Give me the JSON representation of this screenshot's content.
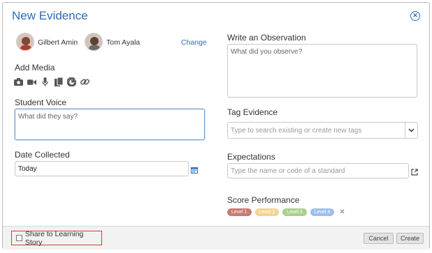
{
  "dialog": {
    "title": "New Evidence"
  },
  "people": [
    {
      "name": "Gilbert Amin"
    },
    {
      "name": "Tom Ayala"
    }
  ],
  "change_link": "Change",
  "add_media": {
    "label": "Add Media",
    "icons": [
      "camera-icon",
      "video-icon",
      "microphone-icon",
      "document-copy-icon",
      "google-icon",
      "link-icon"
    ]
  },
  "student_voice": {
    "label": "Student Voice",
    "placeholder": "What did they say?"
  },
  "date_collected": {
    "label": "Date Collected",
    "value": "Today"
  },
  "observation": {
    "label": "Write an Observation",
    "placeholder": "What did you observe?"
  },
  "tag_evidence": {
    "label": "Tag Evidence",
    "placeholder": "Type to search existing or create new tags"
  },
  "expectations": {
    "label": "Expectations",
    "placeholder": "Type the name or code of a standard"
  },
  "score_performance": {
    "label": "Score Performance",
    "levels": [
      {
        "label": "Level 1",
        "color": "#c97a74"
      },
      {
        "label": "Level 2",
        "color": "#f2d493"
      },
      {
        "label": "Level 3",
        "color": "#a9d08e"
      },
      {
        "label": "Level 4",
        "color": "#9dc0ec"
      }
    ],
    "clear": "✕"
  },
  "footer": {
    "share_label": "Share to Learning Story",
    "cancel": "Cancel",
    "create": "Create"
  },
  "colors": {
    "accent": "#2d6bb5",
    "highlight": "#d83b34"
  }
}
